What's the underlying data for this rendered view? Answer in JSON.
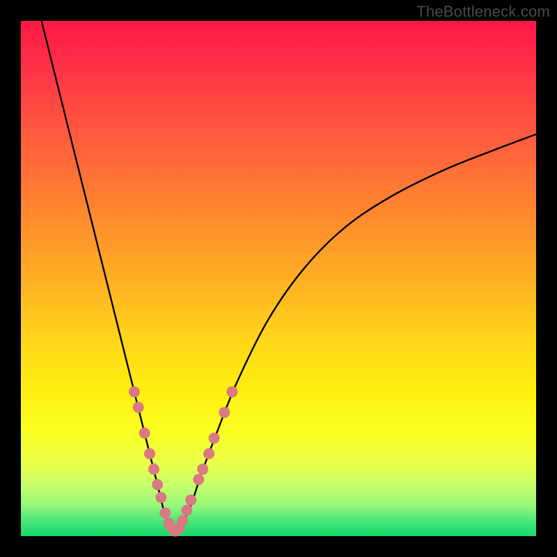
{
  "watermark": "TheBottleneck.com",
  "chart_data": {
    "type": "line",
    "title": "",
    "xlabel": "",
    "ylabel": "",
    "xlim": [
      0,
      100
    ],
    "ylim": [
      0,
      100
    ],
    "grid": false,
    "legend": false,
    "series": [
      {
        "name": "curve",
        "x": [
          4,
          8,
          12,
          16,
          20,
          22,
          24,
          26,
          27,
          28,
          29,
          30,
          31,
          33,
          35,
          38,
          42,
          48,
          55,
          63,
          72,
          82,
          92,
          100
        ],
        "y": [
          100,
          84,
          68,
          52,
          36,
          28,
          20,
          12,
          8,
          4,
          2,
          1,
          2,
          6,
          12,
          20,
          30,
          42,
          52,
          60,
          66,
          71,
          75,
          78
        ]
      }
    ],
    "markers": {
      "name": "highlight-dots",
      "color": "#d97a82",
      "radius": 8,
      "points": [
        {
          "x": 22.0,
          "y": 28
        },
        {
          "x": 22.8,
          "y": 25
        },
        {
          "x": 24.0,
          "y": 20
        },
        {
          "x": 25.0,
          "y": 16
        },
        {
          "x": 25.8,
          "y": 13
        },
        {
          "x": 26.5,
          "y": 10
        },
        {
          "x": 27.2,
          "y": 7.5
        },
        {
          "x": 28.0,
          "y": 4.5
        },
        {
          "x": 28.7,
          "y": 2.5
        },
        {
          "x": 29.3,
          "y": 1.5
        },
        {
          "x": 30.0,
          "y": 1.0
        },
        {
          "x": 30.7,
          "y": 1.5
        },
        {
          "x": 31.4,
          "y": 3.0
        },
        {
          "x": 32.2,
          "y": 5.0
        },
        {
          "x": 33.0,
          "y": 7.0
        },
        {
          "x": 34.5,
          "y": 11.0
        },
        {
          "x": 35.3,
          "y": 13.0
        },
        {
          "x": 36.5,
          "y": 16.0
        },
        {
          "x": 37.5,
          "y": 19.0
        },
        {
          "x": 39.5,
          "y": 24.0
        },
        {
          "x": 41.0,
          "y": 28.0
        }
      ]
    },
    "gradient_stops": [
      {
        "pos": 0,
        "color": "#ff1846"
      },
      {
        "pos": 22,
        "color": "#ff5a3e"
      },
      {
        "pos": 50,
        "color": "#ffae24"
      },
      {
        "pos": 72,
        "color": "#ffef0f"
      },
      {
        "pos": 90,
        "color": "#c8ff6a"
      },
      {
        "pos": 100,
        "color": "#18d66a"
      }
    ]
  }
}
